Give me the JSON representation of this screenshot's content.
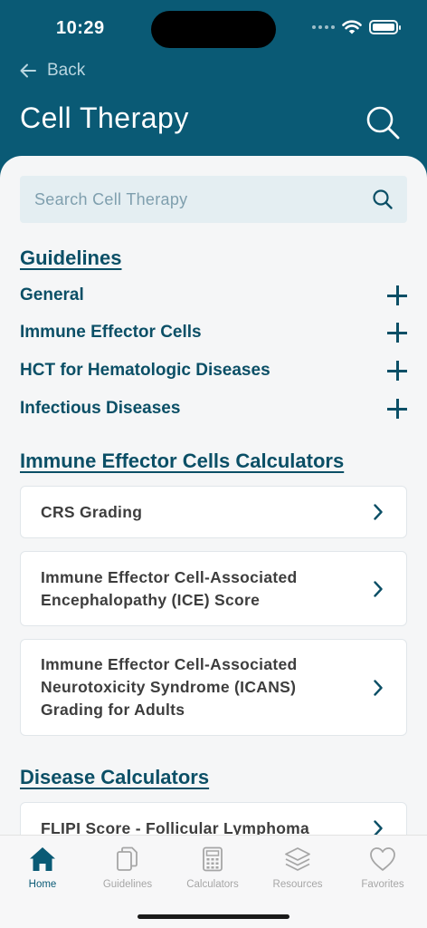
{
  "status": {
    "time": "10:29"
  },
  "header": {
    "back_label": "Back",
    "title": "Cell Therapy"
  },
  "search": {
    "placeholder": "Search Cell Therapy"
  },
  "guidelines": {
    "heading": "Guidelines",
    "items": [
      {
        "label": "General"
      },
      {
        "label": "Immune Effector Cells"
      },
      {
        "label": "HCT for Hematologic Diseases"
      },
      {
        "label": "Infectious Diseases"
      }
    ]
  },
  "iec_calculators": {
    "heading": "Immune Effector Cells Calculators",
    "items": [
      {
        "label": "CRS Grading"
      },
      {
        "label": "Immune Effector Cell-Associated Encephalopathy (ICE) Score"
      },
      {
        "label": "Immune Effector Cell-Associated Neurotoxicity Syndrome (ICANS) Grading for Adults"
      }
    ]
  },
  "disease_calculators": {
    "heading": "Disease Calculators",
    "items": [
      {
        "label": "FLIPI Score - Follicular Lymphoma"
      }
    ]
  },
  "tabbar": {
    "tabs": [
      {
        "label": "Home",
        "icon": "home-icon",
        "active": true
      },
      {
        "label": "Guidelines",
        "icon": "documents-icon",
        "active": false
      },
      {
        "label": "Calculators",
        "icon": "calculator-icon",
        "active": false
      },
      {
        "label": "Resources",
        "icon": "layers-icon",
        "active": false
      },
      {
        "label": "Favorites",
        "icon": "heart-icon",
        "active": false
      }
    ]
  },
  "colors": {
    "brand": "#0a5a75",
    "heading": "#0b4f66",
    "background": "#f5f6f7"
  }
}
